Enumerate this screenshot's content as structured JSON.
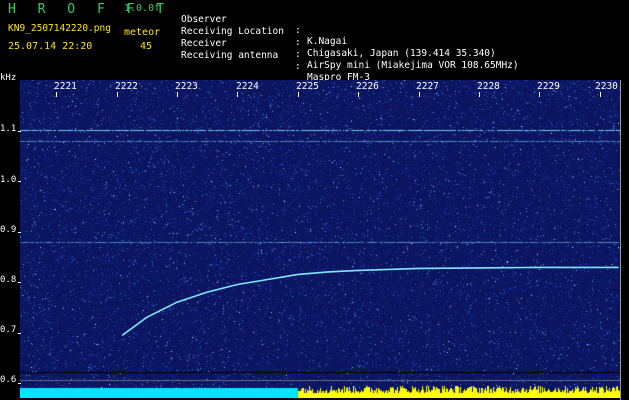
{
  "header": {
    "app_name": "H R O F F T",
    "version": "1.0.0f",
    "filename": "KN9_2507142220.png",
    "type_label": "meteor",
    "timestamp": "25.07.14 22:20",
    "count": "45",
    "info": [
      {
        "key": "Observer",
        "colon": ":",
        "value": "K.Nagai"
      },
      {
        "key": "Receiving Location",
        "colon": ":",
        "value": "Chigasaki, Japan (139.414 35.340)"
      },
      {
        "key": "Receiver",
        "colon": ":",
        "value": "AirSpy mini (Miakejima VOR 108.65MHz)"
      },
      {
        "key": "Receiving antenna",
        "colon": ":",
        "value": "Maspro FM-3"
      }
    ]
  },
  "axes": {
    "y_unit": "kHz",
    "y_ticks": [
      "1.1",
      "1.0",
      "0.9",
      "0.8",
      "0.7",
      "0.6"
    ],
    "x_ticks": [
      "2221",
      "2222",
      "2223",
      "2224",
      "2225",
      "2226",
      "2227",
      "2228",
      "2229",
      "2230"
    ]
  },
  "colors": {
    "background": "#0b1560",
    "trace": "#7fe8ff",
    "cyan_bar": "#00e5ff",
    "yellow_bar": "#ffff00",
    "header_green": "#2fd060",
    "header_yellow": "#ffe600"
  },
  "signal": {
    "description_points_khz": [
      [
        2222.1,
        0.695
      ],
      [
        2222.5,
        0.73
      ],
      [
        2223.0,
        0.76
      ],
      [
        2223.5,
        0.78
      ],
      [
        2224.0,
        0.795
      ],
      [
        2224.5,
        0.805
      ],
      [
        2225.0,
        0.815
      ],
      [
        2225.5,
        0.82
      ],
      [
        2226.0,
        0.823
      ],
      [
        2227.0,
        0.827
      ],
      [
        2228.0,
        0.828
      ],
      [
        2229.0,
        0.829
      ],
      [
        2230.3,
        0.829
      ]
    ],
    "carrier_lines_khz": [
      1.1,
      1.08,
      0.88
    ]
  }
}
